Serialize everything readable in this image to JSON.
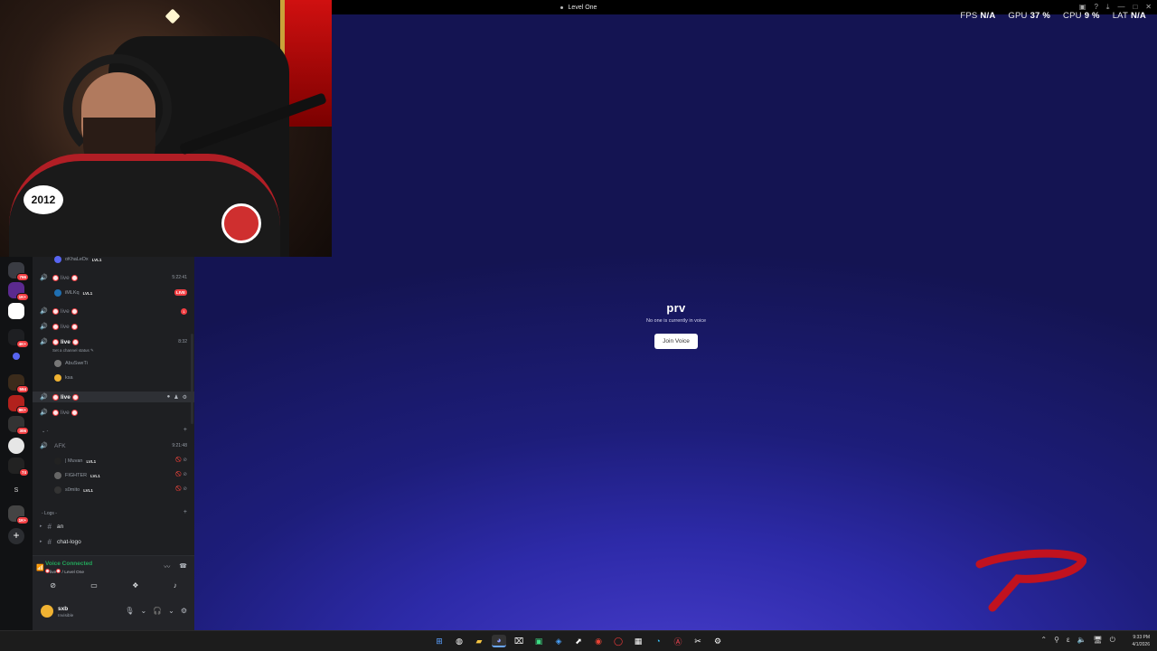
{
  "window": {
    "title": "Level One"
  },
  "stats": [
    {
      "label": "FPS",
      "value": "N/A"
    },
    {
      "label": "GPU",
      "value": "37 %"
    },
    {
      "label": "CPU",
      "value": "9 %"
    },
    {
      "label": "LAT",
      "value": "N/A"
    }
  ],
  "stage": {
    "channel_name": "prv",
    "empty_text": "No one is currently in voice",
    "join_label": "Join Voice"
  },
  "webcam": {
    "jersey_number": "2012"
  },
  "servers": [
    {
      "badge": "766"
    },
    {
      "badge": "1K+"
    },
    {
      "badge": ""
    },
    {
      "badge": "4K+"
    },
    {
      "badge": ""
    },
    {
      "badge": "594"
    },
    {
      "badge": "9K+"
    },
    {
      "badge": "306"
    },
    {
      "badge": ""
    },
    {
      "badge": "74"
    },
    {
      "letter": "S"
    },
    {
      "badge": "1K+"
    }
  ],
  "sidebar": {
    "top_member": {
      "name": "oKhaLeDx",
      "level": "LVL1"
    },
    "channels": [
      {
        "name": "live",
        "timer": "5:22:41",
        "active": false,
        "members": [
          {
            "name": "iMLKq",
            "level": "LVL1",
            "live": "LIVE"
          }
        ]
      },
      {
        "name": "live",
        "timer": "",
        "notif": "1",
        "active": false
      },
      {
        "name": "live",
        "timer": "",
        "active": false
      },
      {
        "name": "live",
        "timer": "8:32",
        "active": true,
        "status": "Set a channel status",
        "members": [
          {
            "name": "AbuSweTi"
          },
          {
            "name": "ksa"
          }
        ]
      },
      {
        "name": "live",
        "timer": "",
        "active": true,
        "hover": true
      },
      {
        "name": "live",
        "timer": "",
        "active": false
      }
    ],
    "afk": {
      "name": "AFK",
      "timer": "9:21:48",
      "members": [
        {
          "name": "| Muvan",
          "level": "LVL1"
        },
        {
          "name": "FIGHTER",
          "level": "LVL1"
        },
        {
          "name": "s0mito",
          "level": "LVL1"
        }
      ]
    },
    "logs_category": "- Logs -",
    "text_channels": [
      "an",
      "chat-logo"
    ]
  },
  "voice": {
    "title": "Voice Connected",
    "subtitle_channel": "live",
    "subtitle_server": "/ Level One"
  },
  "user": {
    "name": "sxb",
    "status": "Invisible"
  },
  "clock": {
    "time": "9:33 PM",
    "date": "4/1/2026"
  },
  "accent": "#5865f2",
  "live_color": "#f23f43",
  "online_color": "#23a55a"
}
